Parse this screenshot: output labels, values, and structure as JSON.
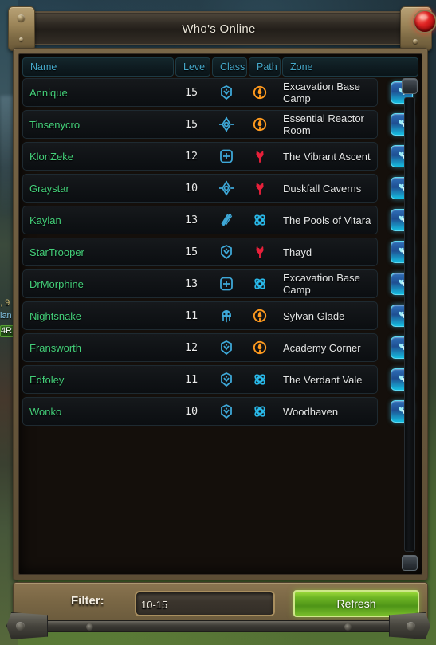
{
  "window": {
    "title": "Who's Online",
    "close_label": "×"
  },
  "columns": [
    {
      "key": "name",
      "label": "Name"
    },
    {
      "key": "level",
      "label": "Level"
    },
    {
      "key": "class",
      "label": "Class"
    },
    {
      "key": "path",
      "label": "Path"
    },
    {
      "key": "zone",
      "label": "Zone"
    }
  ],
  "rows": [
    {
      "name": "Annique",
      "level": "15",
      "class_icon": "class-engineer-icon",
      "class_name": "Engineer",
      "path_icon": "path-soldier-icon",
      "path_name": "Soldier",
      "zone": "Excavation Base Camp",
      "action_icon": "add-friend-icon"
    },
    {
      "name": "Tinsenycro",
      "level": "15",
      "class_icon": "class-spellslinger-icon",
      "class_name": "Spellslinger",
      "path_icon": "path-soldier-icon",
      "path_name": "Soldier",
      "zone": "Essential Reactor Room",
      "action_icon": "add-friend-icon"
    },
    {
      "name": "KlonZeke",
      "level": "12",
      "class_icon": "class-medic-icon",
      "class_name": "Medic",
      "path_icon": "path-settler-icon",
      "path_name": "Settler",
      "zone": "The Vibrant Ascent",
      "action_icon": "add-friend-icon"
    },
    {
      "name": "Graystar",
      "level": "10",
      "class_icon": "class-spellslinger-icon",
      "class_name": "Spellslinger",
      "path_icon": "path-settler-icon",
      "path_name": "Settler",
      "zone": "Duskfall Caverns",
      "action_icon": "add-friend-icon"
    },
    {
      "name": "Kaylan",
      "level": "13",
      "class_icon": "class-stalker-icon",
      "class_name": "Stalker",
      "path_icon": "path-scientist-icon",
      "path_name": "Scientist",
      "zone": "The Pools of Vitara",
      "action_icon": "add-friend-icon"
    },
    {
      "name": "StarTrooper",
      "level": "15",
      "class_icon": "class-engineer-icon",
      "class_name": "Engineer",
      "path_icon": "path-settler-icon",
      "path_name": "Settler",
      "zone": "Thayd",
      "action_icon": "add-friend-icon"
    },
    {
      "name": "DrMorphine",
      "level": "13",
      "class_icon": "class-medic-icon",
      "class_name": "Medic",
      "path_icon": "path-scientist-icon",
      "path_name": "Scientist",
      "zone": "Excavation Base Camp",
      "action_icon": "add-friend-icon"
    },
    {
      "name": "Nightsnake",
      "level": "11",
      "class_icon": "class-esper-icon",
      "class_name": "Esper",
      "path_icon": "path-soldier-icon",
      "path_name": "Soldier",
      "zone": "Sylvan Glade",
      "action_icon": "add-friend-icon"
    },
    {
      "name": "Fransworth",
      "level": "12",
      "class_icon": "class-engineer-icon",
      "class_name": "Engineer",
      "path_icon": "path-soldier-icon",
      "path_name": "Soldier",
      "zone": "Academy Corner",
      "action_icon": "add-friend-icon"
    },
    {
      "name": "Edfoley",
      "level": "11",
      "class_icon": "class-engineer-icon",
      "class_name": "Engineer",
      "path_icon": "path-scientist-icon",
      "path_name": "Scientist",
      "zone": "The Verdant Vale",
      "action_icon": "add-friend-icon"
    },
    {
      "name": "Wonko",
      "level": "10",
      "class_icon": "class-engineer-icon",
      "class_name": "Engineer",
      "path_icon": "path-scientist-icon",
      "path_name": "Scientist",
      "zone": "Woodhaven",
      "action_icon": "add-friend-icon"
    }
  ],
  "footer": {
    "filter_label": "Filter:",
    "filter_value": "10-15",
    "filter_placeholder": "",
    "refresh_label": "Refresh"
  },
  "chat_fragments": [
    ", 9",
    "lan",
    "4R"
  ],
  "colors": {
    "player_name": "#44d07a",
    "column_header": "#45a8c9",
    "zone_text": "#e4e6e6",
    "path_soldier": "#ff9a1e",
    "path_settler": "#e8203a",
    "path_scientist": "#29b8e8",
    "class_icon": "#3ea8d8",
    "refresh_button": "#6eb524",
    "close_gem": "#e02424",
    "frame": "#7a6748"
  }
}
